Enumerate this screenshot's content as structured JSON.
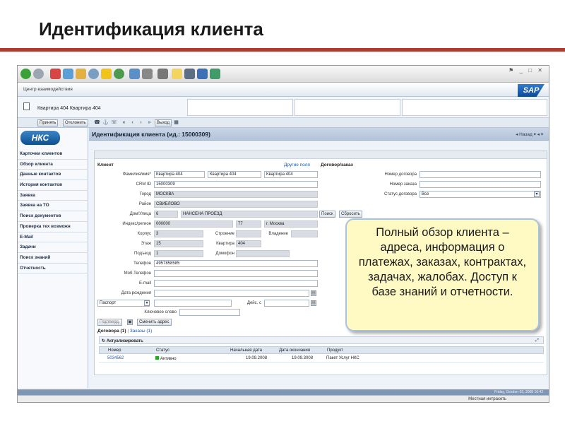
{
  "slide": {
    "title": "Идентификация клиента"
  },
  "app": {
    "title": "Центр взаимодействия",
    "logo": "SAP",
    "brand": "НКС",
    "context_text": "Квартира 404 Квартира 404"
  },
  "toolbar": {
    "accept": "Принять",
    "reject": "Отклонить",
    "exit": "Выход"
  },
  "sidebar": {
    "items": [
      "Карточки клиентов",
      "Обзор клиента",
      "Данные контактов",
      "История контактов",
      "Заявка",
      "Заявка на ТО",
      "Поиск документов",
      "Проверка тех возможн",
      "E-Mail",
      "Задачи",
      "Поиск знаний",
      "Отчетность"
    ]
  },
  "content": {
    "title": "Идентификация клиента (ид.: 15000309)",
    "back": "Назад"
  },
  "client": {
    "section": "Клиент",
    "other_fields": "Другие поля",
    "labels": {
      "name": "Фамилия/имя*",
      "crm": "CRM ID",
      "city": "Город",
      "district": "Район",
      "house": "Дом/Улица",
      "index": "Индекс/регион",
      "korpus": "Корпус",
      "stroenie": "Строение",
      "vladenie": "Владение",
      "floor": "Этаж",
      "flat": "Квартира",
      "entrance": "Подъезд",
      "intercom": "Домофон",
      "phone": "Телефон",
      "mobile": "Моб.Телефон",
      "email": "E-mail",
      "birth": "Дата рождения",
      "valid": "Дейс. с",
      "keyword": "Ключевое слово"
    },
    "values": {
      "name1": "Квартира 404",
      "name2": "Квартира 404",
      "name3": "Квартира 404",
      "crm": "15000309",
      "city": "МОСКВА",
      "district": "СВИБЛОВО",
      "house_no": "6",
      "street": "НАНСЕНА ПРОЕЗД",
      "index": "000000",
      "region_code": "77",
      "region": "г. Москва",
      "korpus": "3",
      "floor": "15",
      "flat": "404",
      "entrance": "1",
      "phone": "4957858585",
      "doc_type": "Паспорт"
    },
    "confirm": "Подтверд.",
    "change_address": "Сменить адрес"
  },
  "contract": {
    "section": "Договор/заказ",
    "labels": {
      "contract_no": "Номер договора",
      "order_no": "Номер заказа",
      "status": "Статус договора"
    },
    "status_value": "Все",
    "search": "Поиск",
    "reset": "Сбросить"
  },
  "tabs": {
    "contracts": "Договора (1)",
    "sep": "|",
    "orders": "Заказы (1)"
  },
  "grid": {
    "refresh": "Актуализировать",
    "headers": [
      "Номер",
      "Статус",
      "Начальная дата",
      "Дата окончания",
      "Продукт"
    ],
    "rows": [
      {
        "number": "5034562",
        "status": "Активно",
        "start": "19.09.2008",
        "end": "19.09.3008",
        "product": "Пакет Услуг НКС"
      }
    ]
  },
  "status": {
    "datetime": "Friday, October 03, 2008 16:42",
    "zone": "Местная интрасеть"
  },
  "callout": {
    "text": "Полный обзор клиента – адреса, информация о платежах, заказах, контрактах, задачах, жалобах. Доступ к базе знаний и отчетности."
  }
}
